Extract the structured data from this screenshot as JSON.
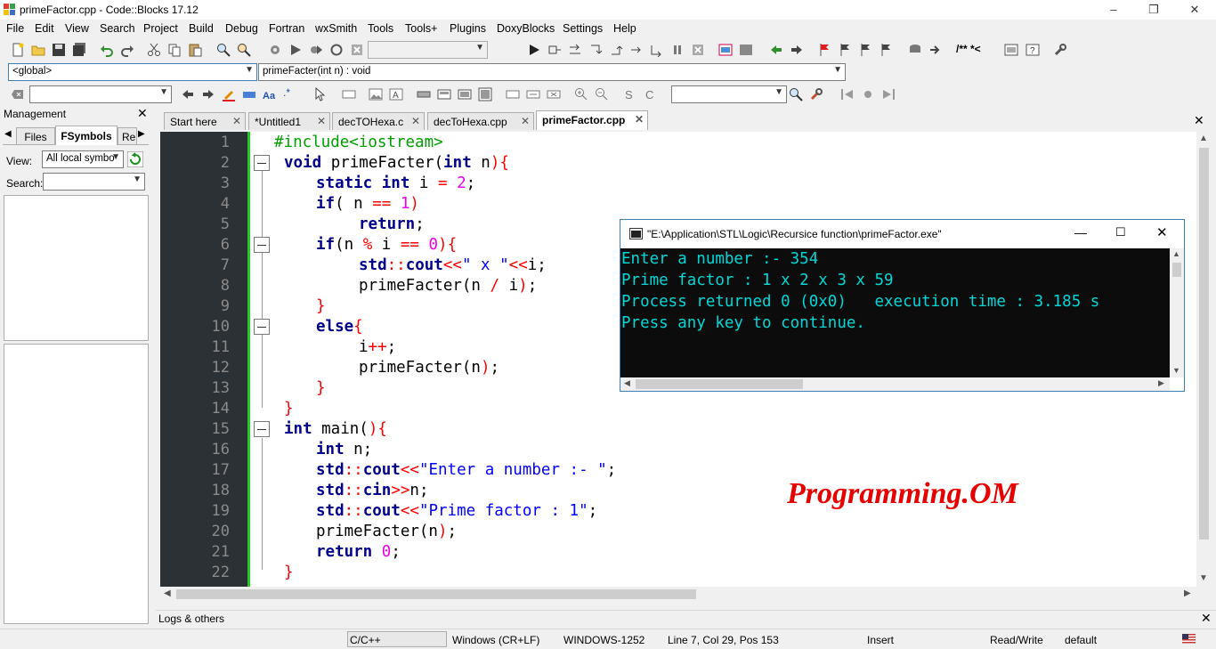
{
  "window": {
    "title": "primeFactor.cpp - Code::Blocks 17.12",
    "minimize": "–",
    "restore": "❐",
    "close": "✕"
  },
  "menu": [
    "File",
    "Edit",
    "View",
    "Search",
    "Project",
    "Build",
    "Debug",
    "Fortran",
    "wxSmith",
    "Tools",
    "Tools+",
    "Plugins",
    "DoxyBlocks",
    "Settings",
    "Help"
  ],
  "toolbar": {
    "scope_value": "<global>",
    "function_value": "primeFacter(int n) : void",
    "regex_label": ".*",
    "doxy_label": "/** *<"
  },
  "management": {
    "title": "Management",
    "tabs": [
      "Files",
      "FSymbols",
      "Re"
    ],
    "active_tab": "FSymbols",
    "view_label": "View:",
    "view_value": "All local symbo",
    "search_label": "Search:"
  },
  "editor_tabs": [
    {
      "label": "Start here"
    },
    {
      "label": "*Untitled1"
    },
    {
      "label": "decTOHexa.c"
    },
    {
      "label": "decToHexa.cpp"
    },
    {
      "label": "primeFactor.cpp",
      "active": true
    }
  ],
  "code_lines": [
    "#include<iostream>",
    "void primeFacter(int n){",
    "static int i = 2;",
    "if( n == 1)",
    "return;",
    "if(n % i == 0){",
    "std::cout<<\" x \"<<i;",
    "primeFacter(n / i);",
    "}",
    "else{",
    "i++;",
    "primeFacter(n);",
    "}",
    "}",
    "int main(){",
    "int n;",
    "std::cout<<\"Enter a number :- \";",
    "std::cin>>n;",
    "std::cout<<\"Prime factor : 1\";",
    "primeFacter(n);",
    "return 0;",
    "}"
  ],
  "line_numbers": [
    "1",
    "2",
    "3",
    "4",
    "5",
    "6",
    "7",
    "8",
    "9",
    "10",
    "11",
    "12",
    "13",
    "14",
    "15",
    "16",
    "17",
    "18",
    "19",
    "20",
    "21",
    "22"
  ],
  "console": {
    "title": "\"E:\\Application\\STL\\Logic\\Recursice function\\primeFactor.exe\"",
    "lines": [
      "Enter a number :- 354",
      "Prime factor : 1 x 2 x 3 x 59",
      "Process returned 0 (0x0)   execution time : 3.185 s",
      "Press any key to continue."
    ]
  },
  "watermark": "Programming.OM",
  "logs": {
    "title": "Logs & others"
  },
  "status": {
    "language": "C/C++",
    "eol": "Windows (CR+LF)",
    "encoding": "WINDOWS-1252",
    "position": "Line 7, Col 29, Pos 153",
    "mode": "Insert",
    "access": "Read/Write",
    "profile": "default"
  },
  "colors": {
    "keyword": "#00008b",
    "preprocessor": "#00a000",
    "string": "#0000ff",
    "number": "#f000f0",
    "operator": "#ff0000",
    "gutter": "#2b3135",
    "console_bg": "#0c0c0c",
    "console_text": "#00d7d7",
    "watermark": "#e60000"
  }
}
